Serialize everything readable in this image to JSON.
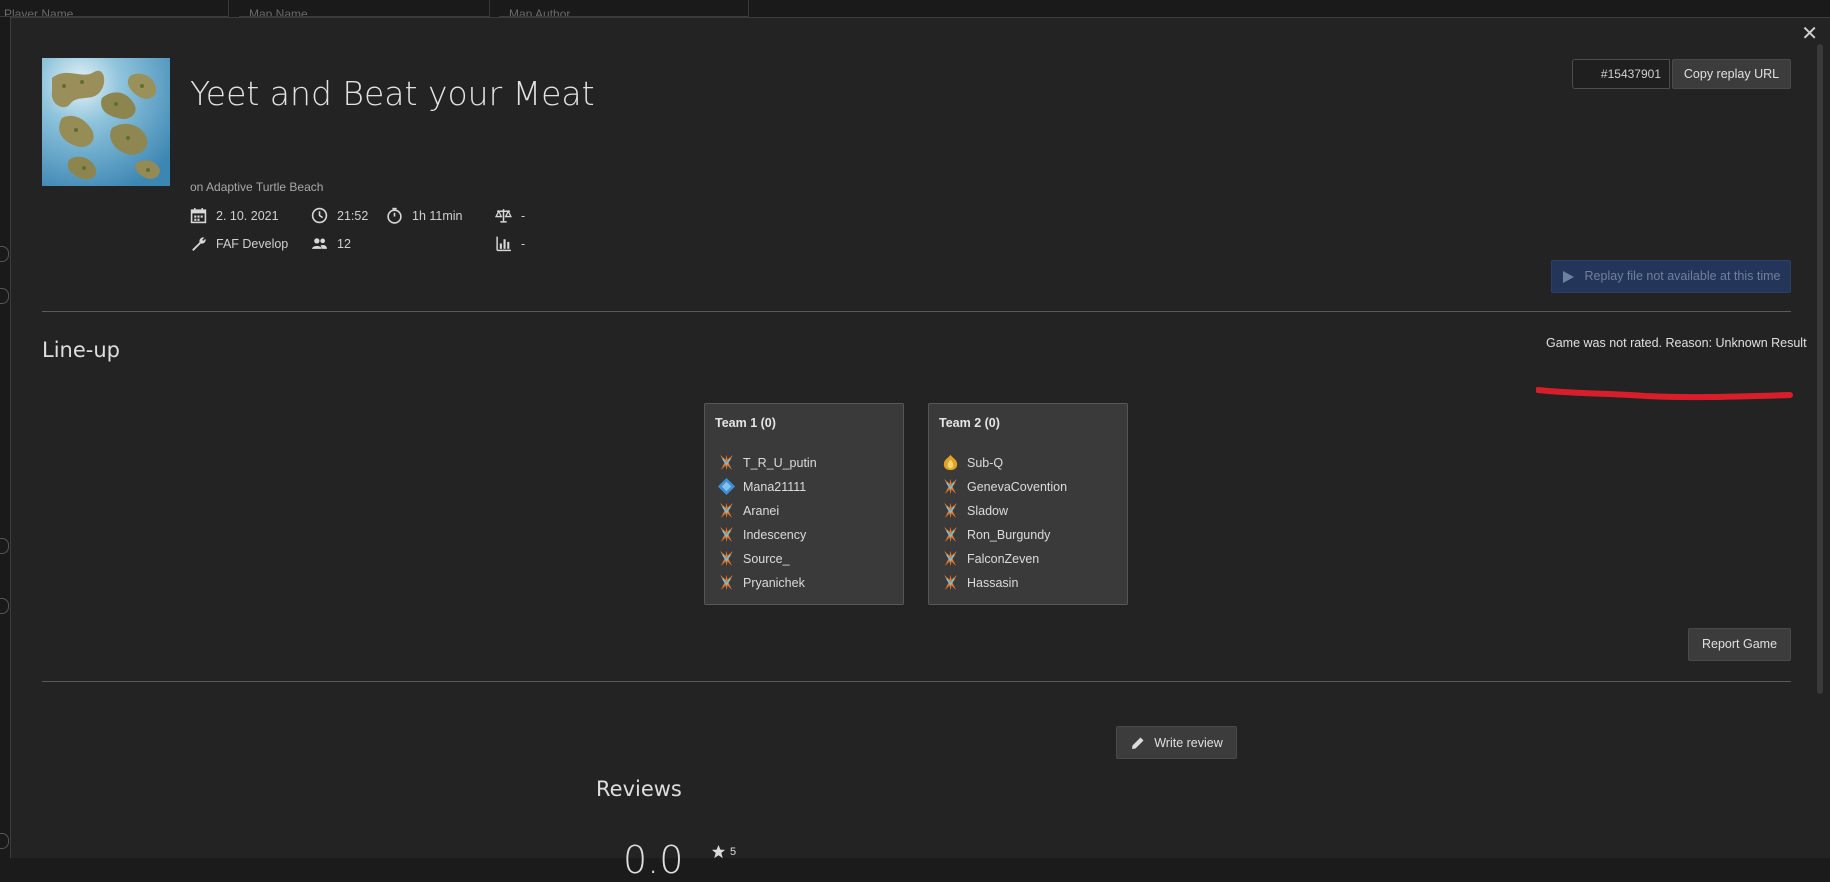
{
  "background": {
    "filters": [
      "Player Name",
      "Map Name",
      "Map Author"
    ]
  },
  "replay": {
    "title": "Yeet and Beat your Meat",
    "map_line": "on Adaptive Turtle Beach",
    "date": "2. 10. 2021",
    "time": "21:52",
    "duration": "1h 11min",
    "balance": "-",
    "featured_mod": "FAF Develop",
    "player_count": "12",
    "rating_stat": "-",
    "replay_id": "#15437901"
  },
  "actions": {
    "copy_url_label": "Copy replay URL",
    "download_label": "Replay file not available at this time",
    "report_label": "Report Game",
    "write_review_label": "Write review"
  },
  "lineup": {
    "title": "Line-up",
    "rating_notice": "Game was not rated. Reason: Unknown Result",
    "teams": [
      {
        "name": "Team 1 (0)",
        "players": [
          {
            "name": "T_R_U_putin",
            "faction": "cybran-icon"
          },
          {
            "name": "Mana21111",
            "faction": "aeon-icon"
          },
          {
            "name": "Aranei",
            "faction": "cybran-icon"
          },
          {
            "name": "Indescency",
            "faction": "cybran-icon"
          },
          {
            "name": "Source_",
            "faction": "cybran-icon"
          },
          {
            "name": "Pryanichek",
            "faction": "cybran-icon"
          }
        ]
      },
      {
        "name": "Team 2 (0)",
        "players": [
          {
            "name": "Sub-Q",
            "faction": "seraphim-icon"
          },
          {
            "name": "GenevaCovention",
            "faction": "cybran-icon"
          },
          {
            "name": "Sladow",
            "faction": "cybran-icon"
          },
          {
            "name": "Ron_Burgundy",
            "faction": "cybran-icon"
          },
          {
            "name": "FalconZeven",
            "faction": "cybran-icon"
          },
          {
            "name": "Hassasin",
            "faction": "cybran-icon"
          }
        ]
      }
    ]
  },
  "reviews": {
    "title": "Reviews",
    "average": "0.0",
    "star_level": "5"
  },
  "colors": {
    "panel": "#232323",
    "download_button": "#24355a",
    "annotation_red": "#d81e2a"
  }
}
